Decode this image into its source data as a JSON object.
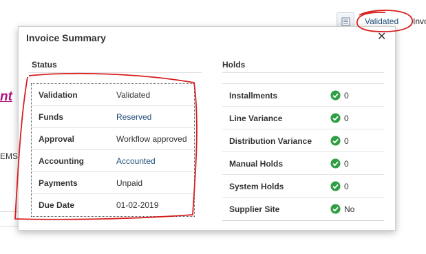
{
  "background": {
    "validated_link": "Validated",
    "partial_right_text": "Invo",
    "partial_left_link": "nt",
    "partial_left_text": "EMS"
  },
  "popup": {
    "title": "Invoice Summary",
    "close_icon": "close-icon",
    "status": {
      "title": "Status",
      "rows": [
        {
          "label": "Validation",
          "value": "Validated",
          "link": false
        },
        {
          "label": "Funds",
          "value": "Reserved",
          "link": true
        },
        {
          "label": "Approval",
          "value": "Workflow approved",
          "link": false
        },
        {
          "label": "Accounting",
          "value": "Accounted",
          "link": true
        },
        {
          "label": "Payments",
          "value": "Unpaid",
          "link": false
        },
        {
          "label": "Due Date",
          "value": "01-02-2019",
          "link": false
        }
      ]
    },
    "holds": {
      "title": "Holds",
      "rows": [
        {
          "label": "Installments",
          "value": "0"
        },
        {
          "label": "Line Variance",
          "value": "0"
        },
        {
          "label": "Distribution Variance",
          "value": "0"
        },
        {
          "label": "Manual Holds",
          "value": "0"
        },
        {
          "label": "System Holds",
          "value": "0"
        },
        {
          "label": "Supplier Site",
          "value": "No"
        }
      ]
    }
  },
  "colors": {
    "link": "#1f4e79",
    "check_green": "#2f9e44",
    "annotation_red": "#d81e1e",
    "pink_link": "#b0127a"
  },
  "icons": [
    "list-icon",
    "close-icon",
    "check-circle-icon"
  ]
}
